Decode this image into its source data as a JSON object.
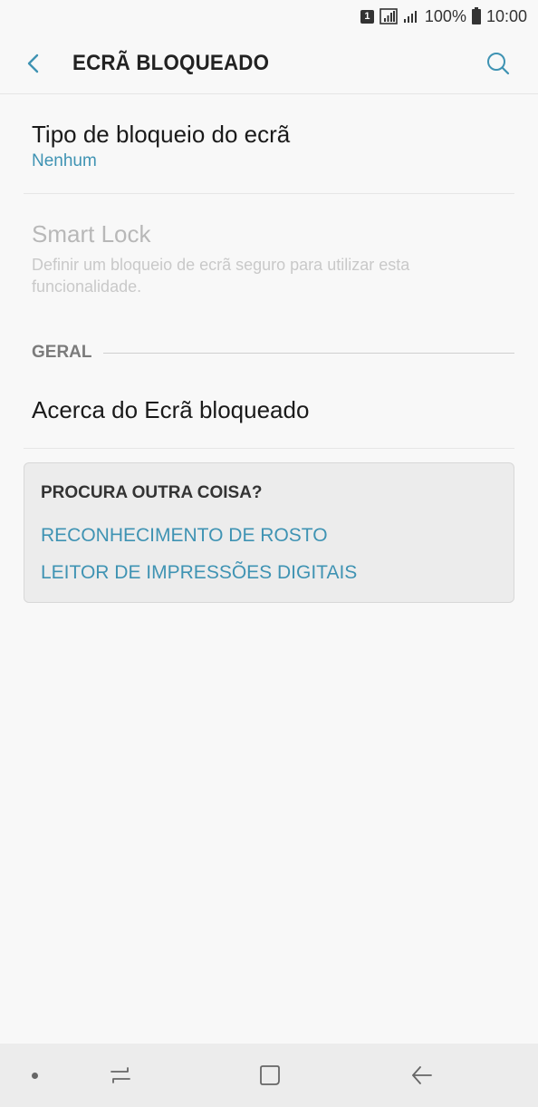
{
  "status_bar": {
    "sim_label": "1",
    "battery_percent": "100%",
    "time": "10:00"
  },
  "app_bar": {
    "title": "ECRÃ BLOQUEADO",
    "back_icon": "chevron-left-icon",
    "search_icon": "search-icon"
  },
  "settings": {
    "lock_type": {
      "title": "Tipo de bloqueio do ecrã",
      "value": "Nenhum"
    },
    "smart_lock": {
      "title": "Smart Lock",
      "description": "Definir um bloqueio de ecrã seguro para utilizar esta funcionalidade."
    },
    "general_section": {
      "label": "GERAL"
    },
    "about": {
      "title": "Acerca do Ecrã bloqueado"
    }
  },
  "suggestions": {
    "title": "PROCURA OUTRA COISA?",
    "links": [
      "RECONHECIMENTO DE ROSTO",
      "LEITOR DE IMPRESSÕES DIGITAIS"
    ]
  },
  "colors": {
    "accent": "#3f93b3",
    "background": "#f8f8f8"
  }
}
